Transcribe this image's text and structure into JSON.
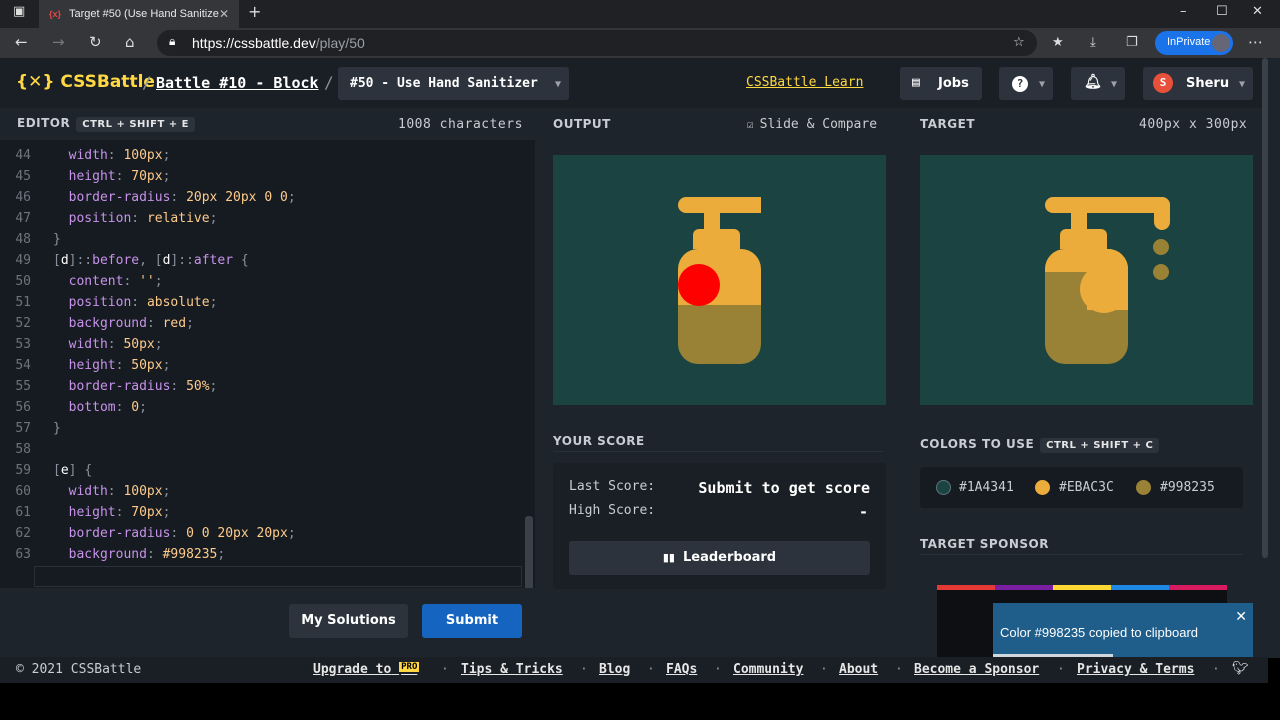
{
  "browser": {
    "tab_title": "Target #50 (Use Hand Sanitizer)",
    "url_host": "https://cssbattle.dev",
    "url_path": "/play/50",
    "inprivate": "InPrivate"
  },
  "header": {
    "logo": "{✕} CSSBattle",
    "battle": "Battle #10 - Block",
    "level": "#50 - Use Hand Sanitizer",
    "learn": "CSSBattle Learn",
    "jobs": "Jobs",
    "help": "?",
    "user": "Sheru",
    "user_initial": "S"
  },
  "editor": {
    "title": "EDITOR",
    "shortcut": "CTRL + SHIFT + E",
    "chars": "1008 characters",
    "lines": [
      {
        "n": "44",
        "code": "  width: 100px;"
      },
      {
        "n": "45",
        "code": "  height: 70px;"
      },
      {
        "n": "46",
        "code": "  border-radius: 20px 20px 0 0;"
      },
      {
        "n": "47",
        "code": "  position: relative;"
      },
      {
        "n": "48",
        "code": "}"
      },
      {
        "n": "49",
        "code": "[d]::before, [d]::after {"
      },
      {
        "n": "50",
        "code": "  content: '';"
      },
      {
        "n": "51",
        "code": "  position: absolute;"
      },
      {
        "n": "52",
        "code": "  background: red;"
      },
      {
        "n": "53",
        "code": "  width: 50px;"
      },
      {
        "n": "54",
        "code": "  height: 50px;"
      },
      {
        "n": "55",
        "code": "  border-radius: 50%;"
      },
      {
        "n": "56",
        "code": "  bottom: 0;"
      },
      {
        "n": "57",
        "code": "}"
      },
      {
        "n": "58",
        "code": ""
      },
      {
        "n": "59",
        "code": "[e] {"
      },
      {
        "n": "60",
        "code": "  width: 100px;"
      },
      {
        "n": "61",
        "code": "  height: 70px;"
      },
      {
        "n": "62",
        "code": "  border-radius: 0 0 20px 20px;"
      },
      {
        "n": "63",
        "code": "  background: #998235;"
      }
    ],
    "my_solutions": "My Solutions",
    "submit": "Submit"
  },
  "output": {
    "title": "OUTPUT",
    "slide": "Slide & Compare"
  },
  "target": {
    "title": "TARGET",
    "size": "400px x 300px"
  },
  "score": {
    "title": "YOUR SCORE",
    "last_label": "Last Score:",
    "last_value": "Submit to get score",
    "high_label": "High Score:",
    "high_value": "-",
    "leaderboard": "Leaderboard"
  },
  "colors": {
    "title": "COLORS TO USE",
    "shortcut": "CTRL + SHIFT + C",
    "items": [
      {
        "hex": "#1A4341",
        "color": "#1A4341"
      },
      {
        "hex": "#EBAC3C",
        "color": "#EBAC3C"
      },
      {
        "hex": "#998235",
        "color": "#998235"
      }
    ]
  },
  "sponsor": {
    "title": "TARGET SPONSOR"
  },
  "toast": {
    "message": "Color #998235 copied to clipboard"
  },
  "footer": {
    "copyright": "© 2021 CSSBattle",
    "upgrade": "Upgrade to",
    "pro": "PRO",
    "links": [
      "Tips & Tricks",
      "Blog",
      "FAQs",
      "Community",
      "About",
      "Become a Sponsor",
      "Privacy & Terms"
    ]
  }
}
